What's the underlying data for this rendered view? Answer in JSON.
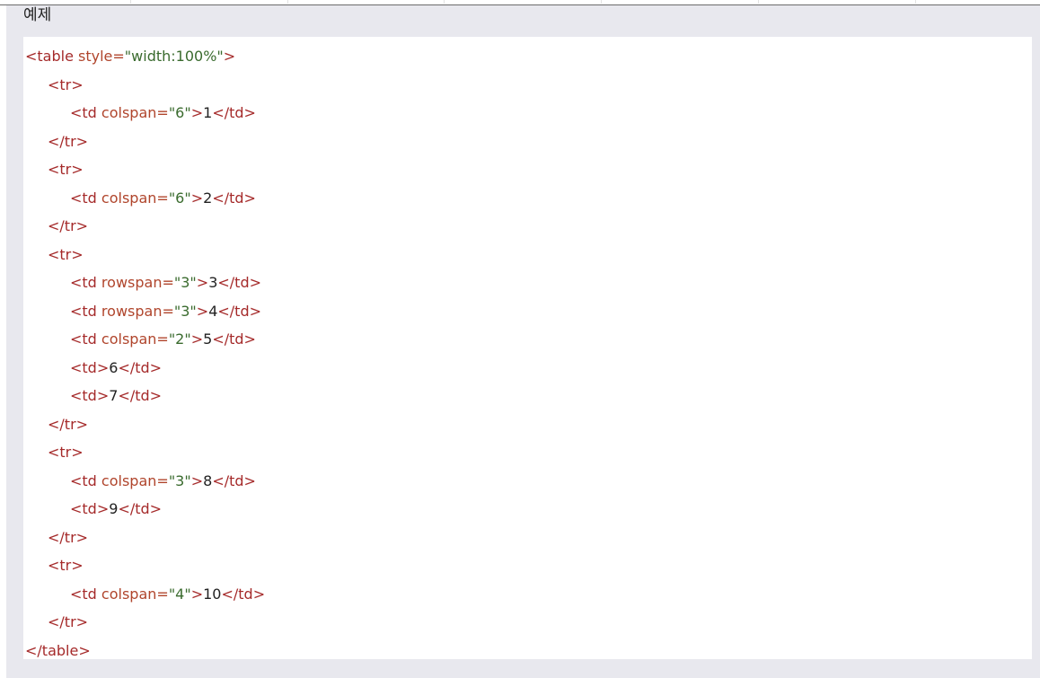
{
  "panel": {
    "title": "예제"
  },
  "code_lines": [
    {
      "indent": 0,
      "parts": [
        {
          "c": "tag",
          "t": "<table"
        },
        {
          "c": "attr",
          "t": " style="
        },
        {
          "c": "val",
          "t": "\"width:100%\""
        },
        {
          "c": "tag",
          "t": ">"
        }
      ]
    },
    {
      "indent": 1,
      "parts": [
        {
          "c": "tag",
          "t": "<tr>"
        }
      ]
    },
    {
      "indent": 2,
      "parts": [
        {
          "c": "tag",
          "t": "<td"
        },
        {
          "c": "attr",
          "t": " colspan="
        },
        {
          "c": "val",
          "t": "\"6\""
        },
        {
          "c": "tag",
          "t": ">"
        },
        {
          "c": "txt",
          "t": "1"
        },
        {
          "c": "tag",
          "t": "</td>"
        }
      ]
    },
    {
      "indent": 1,
      "parts": [
        {
          "c": "tag",
          "t": "</tr>"
        }
      ]
    },
    {
      "indent": 1,
      "parts": [
        {
          "c": "tag",
          "t": "<tr>"
        }
      ]
    },
    {
      "indent": 2,
      "parts": [
        {
          "c": "tag",
          "t": "<td"
        },
        {
          "c": "attr",
          "t": " colspan="
        },
        {
          "c": "val",
          "t": "\"6\""
        },
        {
          "c": "tag",
          "t": ">"
        },
        {
          "c": "txt",
          "t": "2"
        },
        {
          "c": "tag",
          "t": "</td>"
        }
      ]
    },
    {
      "indent": 1,
      "parts": [
        {
          "c": "tag",
          "t": "</tr>"
        }
      ]
    },
    {
      "indent": 1,
      "parts": [
        {
          "c": "tag",
          "t": "<tr>"
        }
      ]
    },
    {
      "indent": 2,
      "parts": [
        {
          "c": "tag",
          "t": "<td"
        },
        {
          "c": "attr",
          "t": " rowspan="
        },
        {
          "c": "val",
          "t": "\"3\""
        },
        {
          "c": "tag",
          "t": ">"
        },
        {
          "c": "txt",
          "t": "3"
        },
        {
          "c": "tag",
          "t": "</td>"
        }
      ]
    },
    {
      "indent": 2,
      "parts": [
        {
          "c": "tag",
          "t": "<td"
        },
        {
          "c": "attr",
          "t": " rowspan="
        },
        {
          "c": "val",
          "t": "\"3\""
        },
        {
          "c": "tag",
          "t": ">"
        },
        {
          "c": "txt",
          "t": "4"
        },
        {
          "c": "tag",
          "t": "</td>"
        }
      ]
    },
    {
      "indent": 2,
      "parts": [
        {
          "c": "tag",
          "t": "<td"
        },
        {
          "c": "attr",
          "t": " colspan="
        },
        {
          "c": "val",
          "t": "\"2\""
        },
        {
          "c": "tag",
          "t": ">"
        },
        {
          "c": "txt",
          "t": "5"
        },
        {
          "c": "tag",
          "t": "</td>"
        }
      ]
    },
    {
      "indent": 2,
      "parts": [
        {
          "c": "tag",
          "t": "<td>"
        },
        {
          "c": "txt",
          "t": "6"
        },
        {
          "c": "tag",
          "t": "</td>"
        }
      ]
    },
    {
      "indent": 2,
      "parts": [
        {
          "c": "tag",
          "t": "<td>"
        },
        {
          "c": "txt",
          "t": "7"
        },
        {
          "c": "tag",
          "t": "</td>"
        }
      ]
    },
    {
      "indent": 1,
      "parts": [
        {
          "c": "tag",
          "t": "</tr>"
        }
      ]
    },
    {
      "indent": 1,
      "parts": [
        {
          "c": "tag",
          "t": "<tr>"
        }
      ]
    },
    {
      "indent": 2,
      "parts": [
        {
          "c": "tag",
          "t": "<td"
        },
        {
          "c": "attr",
          "t": " colspan="
        },
        {
          "c": "val",
          "t": "\"3\""
        },
        {
          "c": "tag",
          "t": ">"
        },
        {
          "c": "txt",
          "t": "8"
        },
        {
          "c": "tag",
          "t": "</td>"
        }
      ]
    },
    {
      "indent": 2,
      "parts": [
        {
          "c": "tag",
          "t": "<td>"
        },
        {
          "c": "txt",
          "t": "9"
        },
        {
          "c": "tag",
          "t": "</td>"
        }
      ]
    },
    {
      "indent": 1,
      "parts": [
        {
          "c": "tag",
          "t": "</tr>"
        }
      ]
    },
    {
      "indent": 1,
      "parts": [
        {
          "c": "tag",
          "t": "<tr>"
        }
      ]
    },
    {
      "indent": 2,
      "parts": [
        {
          "c": "tag",
          "t": "<td"
        },
        {
          "c": "attr",
          "t": " colspan="
        },
        {
          "c": "val",
          "t": "\"4\""
        },
        {
          "c": "tag",
          "t": ">"
        },
        {
          "c": "txt",
          "t": "10"
        },
        {
          "c": "tag",
          "t": "</td>"
        }
      ]
    },
    {
      "indent": 1,
      "parts": [
        {
          "c": "tag",
          "t": "</tr>"
        }
      ]
    },
    {
      "indent": 0,
      "parts": [
        {
          "c": "tag",
          "t": "</table>"
        }
      ]
    }
  ],
  "colors": {
    "panel_bg": "#e8e8ee",
    "code_bg": "#ffffff",
    "tag": "#a52a2a",
    "attr": "#b0452c",
    "value": "#3a6b2e",
    "text": "#222222"
  }
}
